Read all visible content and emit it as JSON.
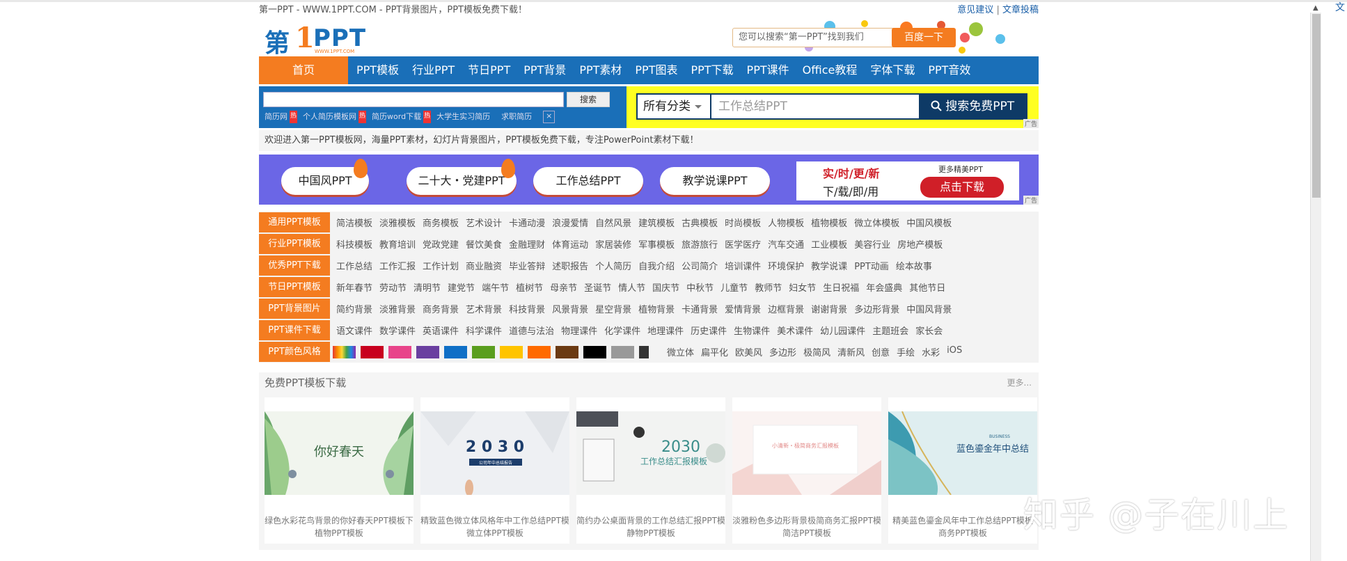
{
  "topbar": {
    "title": "第一PPT - WWW.1PPT.COM - PPT背景图片，PPT模板免费下载！",
    "feedback": "意见建议",
    "sep": "|",
    "submit": "文章投稿"
  },
  "logo": {
    "part1": "第",
    "part2": "1",
    "part3": "PPT",
    "url": "WWW.1PPT.COM"
  },
  "header_search": {
    "placeholder": "您可以搜索“第一PPT”找到我们",
    "button": "百度一下"
  },
  "nav": {
    "home": "首页",
    "items": [
      "PPT模板",
      "行业PPT",
      "节日PPT",
      "PPT背景",
      "PPT素材",
      "PPT图表",
      "PPT下载",
      "PPT课件",
      "Office教程",
      "字体下载",
      "PPT音效"
    ]
  },
  "site_search": {
    "button": "搜索",
    "hot": [
      "简历网",
      "个人简历模板网",
      "简历word下载",
      "大学生实习简历",
      "求职简历"
    ],
    "hot_badge": "热",
    "close": "×"
  },
  "main_search": {
    "category": "所有分类",
    "placeholder": "工作总结PPT",
    "button": "搜索免费PPT",
    "ad": "广告"
  },
  "welcome": "欢迎进入第一PPT模板网，海量PPT素材，幻灯片背景图片，PPT模板免费下载，专注PowerPoint素材下载！",
  "banner": {
    "pills": [
      "中国风PPT",
      "二十大・党建PPT",
      "工作总结PPT",
      "教学说课PPT"
    ],
    "ad_line1": "实/时/更/新",
    "ad_line2": "下/载/即/用",
    "ad_more": "更多精美PPT",
    "ad_button": "点击下载",
    "ad_tag": "广告"
  },
  "categories": [
    {
      "label": "通用PPT模板",
      "links": [
        "简洁模板",
        "淡雅模板",
        "商务模板",
        "艺术设计",
        "卡通动漫",
        "浪漫爱情",
        "自然风景",
        "建筑模板",
        "古典模板",
        "时尚模板",
        "人物模板",
        "植物模板",
        "微立体模板",
        "中国风模板"
      ]
    },
    {
      "label": "行业PPT模板",
      "links": [
        "科技模板",
        "教育培训",
        "党政党建",
        "餐饮美食",
        "金融理财",
        "体育运动",
        "家居装修",
        "军事模板",
        "旅游旅行",
        "医学医疗",
        "汽车交通",
        "工业模板",
        "美容行业",
        "房地产模板"
      ]
    },
    {
      "label": "优秀PPT下载",
      "links": [
        "工作总结",
        "工作汇报",
        "工作计划",
        "商业融资",
        "毕业答辩",
        "述职报告",
        "个人简历",
        "自我介绍",
        "公司简介",
        "培训课件",
        "环境保护",
        "教学说课",
        "PPT动画",
        "绘本故事"
      ]
    },
    {
      "label": "节日PPT模板",
      "links": [
        "新年春节",
        "劳动节",
        "清明节",
        "建党节",
        "端午节",
        "植树节",
        "母亲节",
        "圣诞节",
        "情人节",
        "国庆节",
        "中秋节",
        "儿童节",
        "教师节",
        "妇女节",
        "生日祝福",
        "年会盛典",
        "其他节日"
      ]
    },
    {
      "label": "PPT背景图片",
      "links": [
        "简约背景",
        "淡雅背景",
        "商务背景",
        "艺术背景",
        "科技背景",
        "风景背景",
        "星空背景",
        "植物背景",
        "卡通背景",
        "爱情背景",
        "边框背景",
        "谢谢背景",
        "多边形背景",
        "中国风背景"
      ]
    },
    {
      "label": "PPT课件下载",
      "links": [
        "语文课件",
        "数学课件",
        "英语课件",
        "科学课件",
        "道德与法治",
        "物理课件",
        "化学课件",
        "地理课件",
        "历史课件",
        "生物课件",
        "美术课件",
        "幼儿园课件",
        "主题班会",
        "家长会"
      ]
    }
  ],
  "color_row": {
    "label": "PPT颜色风格",
    "colors": [
      "#c8001e",
      "#e8448a",
      "#6a3fa0",
      "#0f6fc6",
      "#5a9e1e",
      "#ffc400",
      "#ff6a00",
      "#6b3a12",
      "#000000",
      "#999999",
      "#333333"
    ],
    "styles": [
      "微立体",
      "扁平化",
      "欧美风",
      "多边形",
      "极简风",
      "清新风",
      "创意",
      "手绘",
      "水彩",
      "iOS"
    ]
  },
  "free_section": {
    "title": "免费PPT模板下载",
    "more": "更多..."
  },
  "cards": [
    {
      "line1": "绿色水彩花鸟背景的你好春天PPT模板下",
      "line2": "植物PPT模板",
      "img_text": "你好春天"
    },
    {
      "line1": "精致蓝色微立体风格年中工作总结PPT模",
      "line2": "微立体PPT模板",
      "img_text": "2 0 3 0",
      "img_sub": "公司年中总结报告"
    },
    {
      "line1": "简约办公桌面背景的工作总结汇报PPT模",
      "line2": "静物PPT模板",
      "img_text": "2030",
      "img_sub": "工作总结汇报模板"
    },
    {
      "line1": "淡雅粉色多边形背景极简商务汇报PPT模",
      "line2": "简洁PPT模板",
      "img_text": "小清新・极简商务汇报模板"
    },
    {
      "line1": "精美蓝色鎏金风年中工作总结PPT模板",
      "line2": "商务PPT模板",
      "img_text": "蓝色鎏金年中总结",
      "img_sub": "BUSINESS"
    }
  ],
  "watermark": "知乎 @子在川上"
}
